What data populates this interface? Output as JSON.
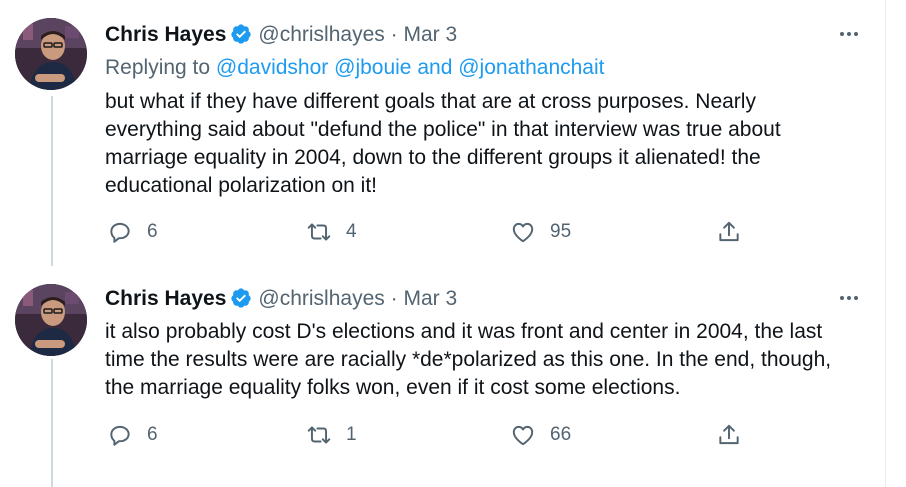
{
  "tweets": [
    {
      "name": "Chris Hayes",
      "handle": "@chrislhayes",
      "separator": "·",
      "date": "Mar 3",
      "replying_prefix": "Replying to",
      "replying_mention_1": "@davidshor",
      "replying_mention_2": "@jbouie",
      "replying_and": "and",
      "replying_mention_3": "@jonathanchait",
      "text": "but what if they have different goals that are at cross purposes. Nearly everything said about \"defund the police\" in that interview was true about marriage equality in 2004, down to the different groups it alienated! the educational polarization on it!",
      "replies": "6",
      "retweets": "4",
      "likes": "95"
    },
    {
      "name": "Chris Hayes",
      "handle": "@chrislhayes",
      "separator": "·",
      "date": "Mar 3",
      "text": "it also probably cost D's elections and it was front and center in 2004, the last time the results were are racially *de*polarized as this one. In the end, though, the marriage equality folks won, even if it cost some elections.",
      "replies": "6",
      "retweets": "1",
      "likes": "66"
    }
  ],
  "icons": {
    "verified": "verified-badge-icon",
    "more": "more-dots-icon",
    "reply": "reply-bubble-icon",
    "retweet": "retweet-icon",
    "like": "heart-icon",
    "share": "share-upload-icon"
  },
  "colors": {
    "link": "#1d9bf0",
    "muted": "#536471",
    "thread_line": "#cfd9de",
    "verified": "#1d9bf0"
  }
}
